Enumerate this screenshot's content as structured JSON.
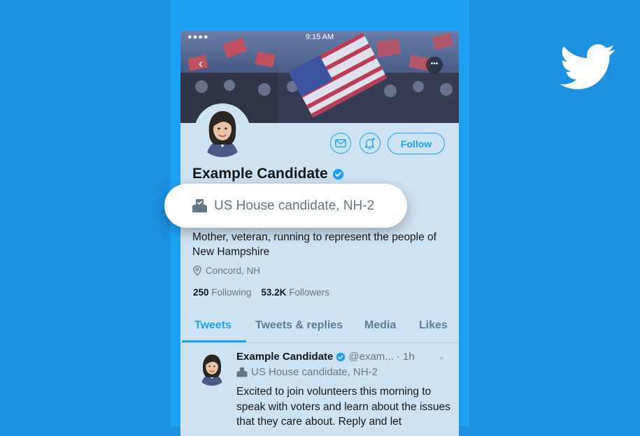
{
  "status_bar": {
    "time": "9:15 AM"
  },
  "profile": {
    "display_name": "Example Candidate",
    "election_label": "US House candidate, NH-2",
    "bio": "Mother, veteran, running to represent the people of New Hampshire",
    "location": "Concord, NH",
    "following_count": "250",
    "following_label": "Following",
    "followers_count": "53.2K",
    "followers_label": "Followers"
  },
  "actions": {
    "follow_label": "Follow"
  },
  "tabs": [
    {
      "label": "Tweets",
      "active": true
    },
    {
      "label": "Tweets & replies",
      "active": false
    },
    {
      "label": "Media",
      "active": false
    },
    {
      "label": "Likes",
      "active": false
    }
  ],
  "tweet": {
    "name": "Example Candidate",
    "handle": "@exam...",
    "time": "· 1h",
    "label": "US House candidate, NH-2",
    "text": "Excited to join volunteers this morning to speak with voters and learn about the issues that they care about. Reply and let"
  },
  "colors": {
    "brand": "#1da1f2",
    "background": "#1d90e0",
    "profile_bg": "#cde3f4",
    "text_primary": "#14171a",
    "text_secondary": "#657786"
  },
  "icons": {
    "brand_logo": "twitter-bird-icon",
    "verified": "verified-badge-icon",
    "message": "envelope-icon",
    "notifications": "bell-plus-icon",
    "location": "location-pin-icon",
    "election": "ballot-box-icon",
    "back": "back-arrow-icon",
    "more": "more-icon",
    "tweet_menu": "chevron-down-icon"
  }
}
